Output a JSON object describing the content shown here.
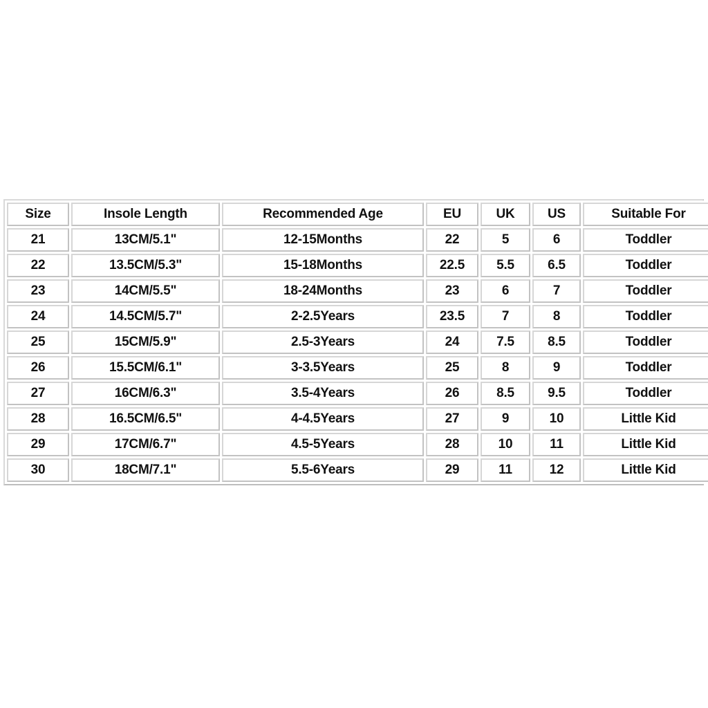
{
  "page": {
    "background_color": "#ffffff",
    "text_color": "#111111",
    "cell_border_color": "#c2c2c2",
    "table_border_color": "#c9c9c9"
  },
  "chart_data": {
    "type": "table",
    "title": "",
    "columns": [
      "Size",
      "Insole Length",
      "Recommended Age",
      "EU",
      "UK",
      "US",
      "Suitable For"
    ],
    "rows": [
      [
        "21",
        "13CM/5.1\"",
        "12-15Months",
        "22",
        "5",
        "6",
        "Toddler"
      ],
      [
        "22",
        "13.5CM/5.3\"",
        "15-18Months",
        "22.5",
        "5.5",
        "6.5",
        "Toddler"
      ],
      [
        "23",
        "14CM/5.5\"",
        "18-24Months",
        "23",
        "6",
        "7",
        "Toddler"
      ],
      [
        "24",
        "14.5CM/5.7\"",
        "2-2.5Years",
        "23.5",
        "7",
        "8",
        "Toddler"
      ],
      [
        "25",
        "15CM/5.9\"",
        "2.5-3Years",
        "24",
        "7.5",
        "8.5",
        "Toddler"
      ],
      [
        "26",
        "15.5CM/6.1\"",
        "3-3.5Years",
        "25",
        "8",
        "9",
        "Toddler"
      ],
      [
        "27",
        "16CM/6.3\"",
        "3.5-4Years",
        "26",
        "8.5",
        "9.5",
        "Toddler"
      ],
      [
        "28",
        "16.5CM/6.5\"",
        "4-4.5Years",
        "27",
        "9",
        "10",
        "Little Kid"
      ],
      [
        "29",
        "17CM/6.7\"",
        "4.5-5Years",
        "28",
        "10",
        "11",
        "Little Kid"
      ],
      [
        "30",
        "18CM/7.1\"",
        "5.5-6Years",
        "29",
        "11",
        "12",
        "Little Kid"
      ]
    ]
  }
}
